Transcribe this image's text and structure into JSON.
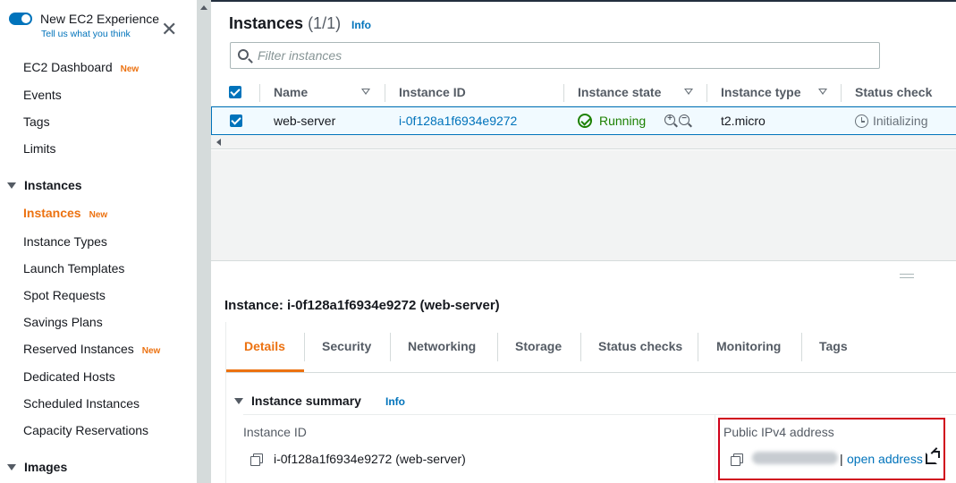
{
  "sidebar": {
    "toggle": {
      "title": "New EC2 Experience",
      "subtitle": "Tell us what you think"
    },
    "items": [
      {
        "label": "EC2 Dashboard",
        "badge": "New"
      },
      {
        "label": "Events"
      },
      {
        "label": "Tags"
      },
      {
        "label": "Limits"
      }
    ],
    "sections": [
      {
        "label": "Instances"
      },
      {
        "label": "Images"
      }
    ],
    "instances_items": [
      {
        "label": "Instances",
        "badge": "New",
        "active": true
      },
      {
        "label": "Instance Types"
      },
      {
        "label": "Launch Templates"
      },
      {
        "label": "Spot Requests"
      },
      {
        "label": "Savings Plans"
      },
      {
        "label": "Reserved Instances",
        "badge": "New"
      },
      {
        "label": "Dedicated Hosts"
      },
      {
        "label": "Scheduled Instances"
      },
      {
        "label": "Capacity Reservations"
      }
    ]
  },
  "header": {
    "title": "Instances",
    "count": "(1/1)",
    "info": "Info"
  },
  "search": {
    "placeholder": "Filter instances"
  },
  "table": {
    "columns": [
      "Name",
      "Instance ID",
      "Instance state",
      "Instance type",
      "Status check"
    ],
    "rows": [
      {
        "name": "web-server",
        "instance_id": "i-0f128a1f6934e9272",
        "state": "Running",
        "type": "t2.micro",
        "status_check": "Initializing"
      }
    ]
  },
  "details": {
    "title": "Instance: i-0f128a1f6934e9272 (web-server)",
    "tabs": [
      "Details",
      "Security",
      "Networking",
      "Storage",
      "Status checks",
      "Monitoring",
      "Tags"
    ],
    "active_tab": "Details",
    "summary": {
      "heading": "Instance summary",
      "info": "Info",
      "instance_id_label": "Instance ID",
      "instance_id_value": "i-0f128a1f6934e9272 (web-server)",
      "public_ipv4_label": "Public IPv4 address",
      "ip_separator": "|",
      "open_address": "open address"
    }
  },
  "colors": {
    "accent": "#ec7211",
    "link": "#0073bb",
    "success": "#1d8102",
    "highlight_border": "#d0021b"
  }
}
